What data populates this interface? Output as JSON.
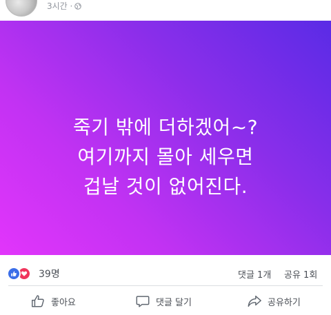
{
  "post": {
    "time": "3시간 ·",
    "privacy_icon": "globe-icon",
    "lines": [
      "죽기 밖에 더하겠어~?",
      "여기까지 몰아 세우면",
      "겁날 것이 없어진다."
    ],
    "background_gradient": [
      "#5a2be6",
      "#c232f3",
      "#e235fb"
    ]
  },
  "reactions": {
    "icons": [
      "like-icon",
      "love-icon"
    ],
    "count": "39명",
    "comments": "댓글 1개",
    "shares": "공유 1회"
  },
  "actions": {
    "like": "좋아요",
    "comment": "댓글 달기",
    "share": "공유하기"
  },
  "colors": {
    "like_blue": "#3b6ee8",
    "love_red": "#f0355c"
  }
}
